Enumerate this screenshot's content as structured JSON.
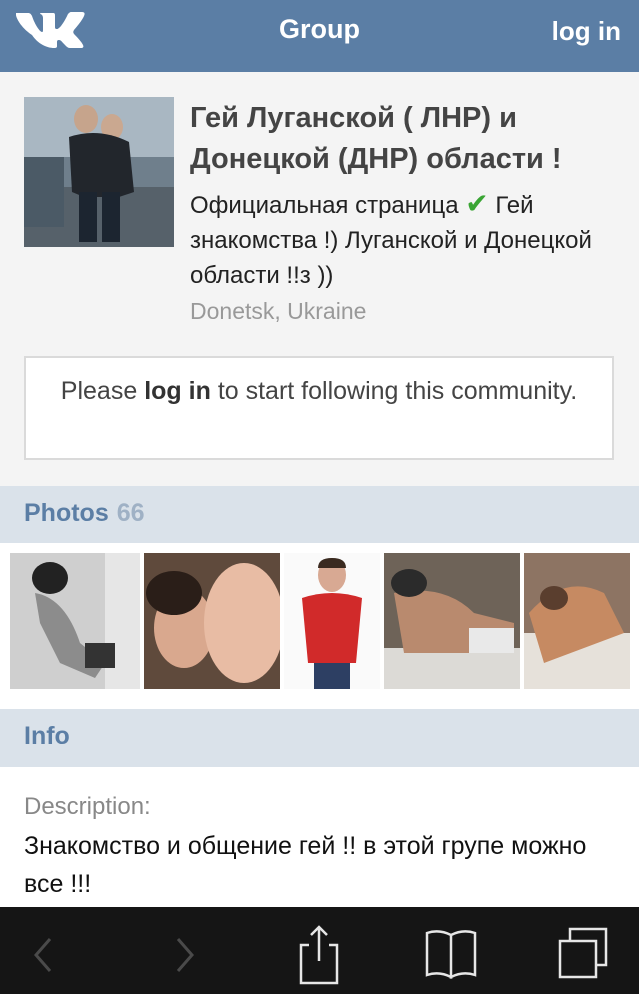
{
  "topbar": {
    "title": "Group",
    "login_label": "log in",
    "bg_color": "#5b7ea5"
  },
  "group": {
    "name": "Гей Луганской ( ЛНР) и Донецкой (ДНР) области !",
    "status_before": "Официальная страница",
    "status_after": "Гей знакомства !) Луганской и Донецкой области !!з ))",
    "location": "Donetsk, Ukraine"
  },
  "follow": {
    "before": "Please",
    "link": "log in",
    "after": "to start following this community."
  },
  "photos": {
    "title": "Photos",
    "count": "66"
  },
  "info": {
    "title": "Info",
    "description_label": "Description:",
    "description_text": "Знакомство и общение гей !! в этой групе можно все !!!"
  },
  "icons": [
    "vk-logo",
    "checkmark-icon",
    "back-arrow-icon",
    "forward-arrow-icon",
    "share-icon",
    "bookmarks-icon",
    "tabs-icon"
  ]
}
